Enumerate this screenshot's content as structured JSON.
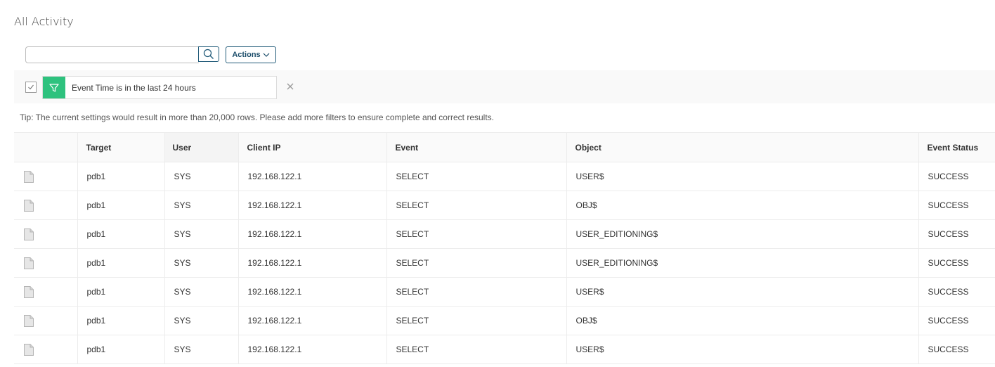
{
  "page": {
    "title": "All Activity"
  },
  "toolbar": {
    "search_value": "",
    "search_placeholder": "",
    "search_icon": "search-icon",
    "actions_label": "Actions",
    "actions_icon": "chevron-down-icon"
  },
  "filters": [
    {
      "label": "Event Time is in the last 24 hours",
      "checked": true,
      "icon": "filter-funnel-icon"
    }
  ],
  "tip": "Tip: The current settings would result in more than 20,000 rows. Please add more filters to ensure complete and correct results.",
  "table": {
    "columns": [
      "",
      "Target",
      "User",
      "Client IP",
      "Event",
      "Object",
      "Event Status"
    ],
    "rows": [
      {
        "icon": "document-icon",
        "target": "pdb1",
        "user": "SYS",
        "client_ip": "192.168.122.1",
        "event": "SELECT",
        "object": "USER$",
        "event_status": "SUCCESS"
      },
      {
        "icon": "document-icon",
        "target": "pdb1",
        "user": "SYS",
        "client_ip": "192.168.122.1",
        "event": "SELECT",
        "object": "OBJ$",
        "event_status": "SUCCESS"
      },
      {
        "icon": "document-icon",
        "target": "pdb1",
        "user": "SYS",
        "client_ip": "192.168.122.1",
        "event": "SELECT",
        "object": "USER_EDITIONING$",
        "event_status": "SUCCESS"
      },
      {
        "icon": "document-icon",
        "target": "pdb1",
        "user": "SYS",
        "client_ip": "192.168.122.1",
        "event": "SELECT",
        "object": "USER_EDITIONING$",
        "event_status": "SUCCESS"
      },
      {
        "icon": "document-icon",
        "target": "pdb1",
        "user": "SYS",
        "client_ip": "192.168.122.1",
        "event": "SELECT",
        "object": "USER$",
        "event_status": "SUCCESS"
      },
      {
        "icon": "document-icon",
        "target": "pdb1",
        "user": "SYS",
        "client_ip": "192.168.122.1",
        "event": "SELECT",
        "object": "OBJ$",
        "event_status": "SUCCESS"
      },
      {
        "icon": "document-icon",
        "target": "pdb1",
        "user": "SYS",
        "client_ip": "192.168.122.1",
        "event": "SELECT",
        "object": "USER$",
        "event_status": "SUCCESS"
      }
    ]
  },
  "colors": {
    "accent": "#235c7a",
    "filter_green": "#2ec27e",
    "filter_bar_bg": "#f9f9f9"
  }
}
